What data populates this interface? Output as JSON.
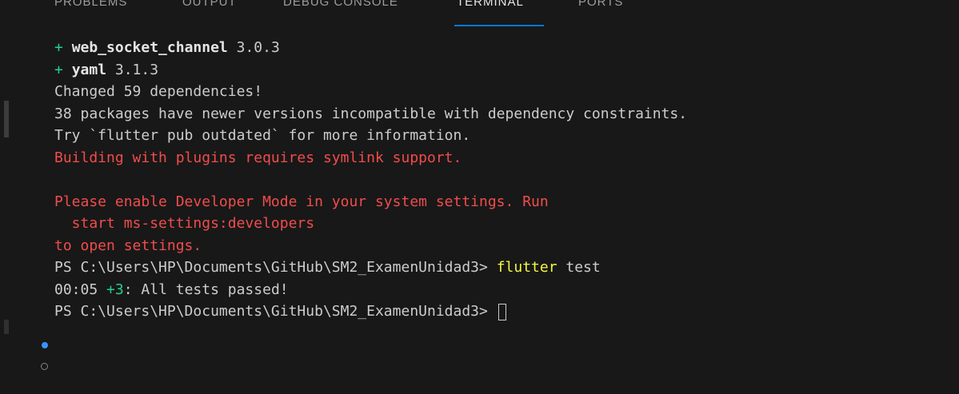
{
  "tabs": [
    {
      "label": "PROBLEMS"
    },
    {
      "label": "OUTPUT"
    },
    {
      "label": "DEBUG CONSOLE"
    },
    {
      "label": "TERMINAL",
      "active": true
    },
    {
      "label": "PORTS"
    }
  ],
  "terminal": {
    "line1": {
      "prefix": "+ ",
      "pkg": "web_socket_channel",
      "version": " 3.0.3"
    },
    "line2": {
      "prefix": "+ ",
      "pkg": "yaml",
      "version": " 3.1.3"
    },
    "line3": "Changed 59 dependencies!",
    "line4": "38 packages have newer versions incompatible with dependency constraints.",
    "line5": "Try `flutter pub outdated` for more information.",
    "line6": "Building with plugins requires symlink support.",
    "line7": "",
    "line8": "Please enable Developer Mode in your system settings. Run",
    "line9": "  start ms-settings:developers",
    "line10": "to open settings.",
    "line11": {
      "prompt": "PS C:\\Users\\HP\\Documents\\GitHub\\SM2_ExamenUnidad3> ",
      "command": "flutter",
      "args": " test"
    },
    "line12": {
      "time": "00:05 ",
      "count": "+3",
      "message": ": All tests passed!"
    },
    "line13": {
      "prompt": "PS C:\\Users\\HP\\Documents\\GitHub\\SM2_ExamenUnidad3> "
    }
  },
  "colors": {
    "background": "#181818",
    "success_green": "#23d18b",
    "error_red": "#f14c4c",
    "command_yellow": "#f5f543",
    "active_tab_underline": "#0078d4",
    "status_dot_blue": "#3794ff"
  }
}
